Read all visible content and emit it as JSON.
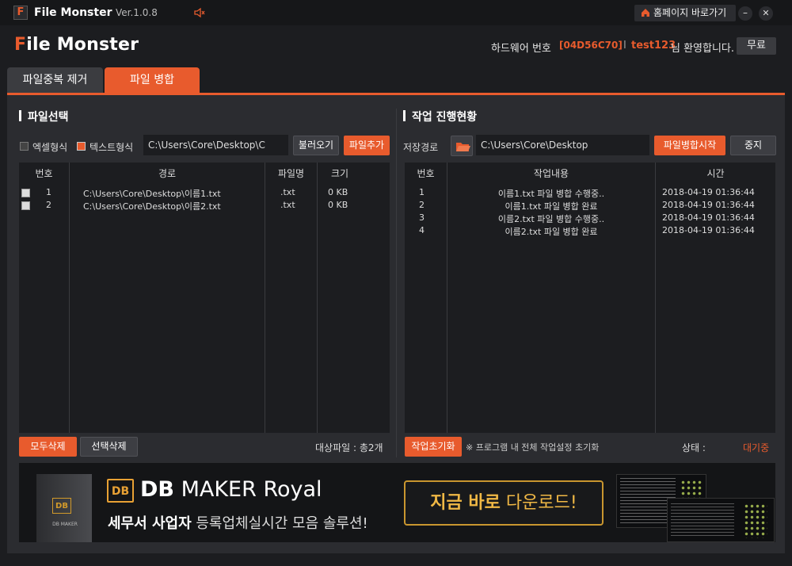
{
  "titlebar": {
    "logo_letter": "F",
    "app_name": "File Monster",
    "version": "Ver.1.0.8",
    "home_button": "홈페이지 바로가기",
    "minimize": "–",
    "close": "✕"
  },
  "header": {
    "brand_first": "F",
    "brand_rest": "ile Monster",
    "hardware_label": "하드웨어 번호",
    "hardware_value": "[04D56C70]",
    "separator": "I",
    "user_id": "test123",
    "welcome": "님 환영합니다.",
    "plan": "무료"
  },
  "tabs": [
    {
      "label": "파일중복 제거"
    },
    {
      "label": "파일 병합"
    }
  ],
  "left_panel": {
    "title": "파일선택",
    "excel_label": "엑셀형식",
    "text_label": "텍스트형식",
    "path": "C:\\Users\\Core\\Desktop\\C",
    "load_button": "불러오기",
    "add_button": "파일추가",
    "columns": [
      "번호",
      "경로",
      "파일명",
      "크기"
    ],
    "rows": [
      {
        "no": "1",
        "path": "C:\\Users\\Core\\Desktop\\이름1.txt",
        "name": ".txt",
        "size": "0 KB"
      },
      {
        "no": "2",
        "path": "C:\\Users\\Core\\Desktop\\이름2.txt",
        "name": ".txt",
        "size": "0 KB"
      }
    ],
    "delete_all": "모두삭제",
    "delete_selected": "선택삭제",
    "count": "대상파일 : 총2개"
  },
  "right_panel": {
    "title": "작업 진행현황",
    "save_label": "저장경로",
    "path": "C:\\Users\\Core\\Desktop",
    "start_button": "파일병합시작",
    "stop_button": "중지",
    "columns": [
      "번호",
      "작업내용",
      "시간"
    ],
    "rows": [
      {
        "no": "1",
        "task": "이름1.txt 파일 병합 수행중..",
        "time": "2018-04-19 01:36:44"
      },
      {
        "no": "2",
        "task": "이름1.txt 파일 병합 완료",
        "time": "2018-04-19 01:36:44"
      },
      {
        "no": "3",
        "task": "이름2.txt 파일 병합 수행중..",
        "time": "2018-04-19 01:36:44"
      },
      {
        "no": "4",
        "task": "이름2.txt 파일 병합 완료",
        "time": "2018-04-19 01:36:44"
      }
    ],
    "reset_button": "작업초기화",
    "reset_note": "※ 프로그램 내 전체 작업설정 초기화",
    "status_label": "상태 :",
    "status_value": "대기중"
  },
  "ad": {
    "logo_text": "DB",
    "product_bold": "DB",
    "product_rest": " MAKER Royal",
    "tagline_bold": "세무서 사업자",
    "tagline_rest": " 등록업체실시간 모음 솔루션!",
    "cta_bold": "지금 바로",
    "cta_rest": " 다운로드!",
    "box_label": "DB MAKER"
  },
  "colors": {
    "accent": "#e85b2d",
    "background": "#1c1d20",
    "panel": "#2b2c30"
  }
}
